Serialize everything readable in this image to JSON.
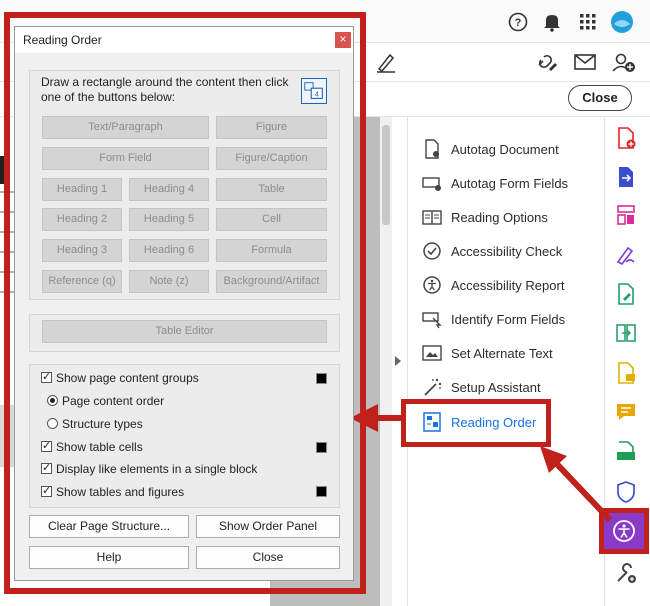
{
  "app": {
    "close_label": "Close"
  },
  "tool_panel": {
    "items": [
      {
        "label": "Autotag Document",
        "icon": "autotag-document-icon"
      },
      {
        "label": "Autotag Form Fields",
        "icon": "autotag-form-fields-icon"
      },
      {
        "label": "Reading Options",
        "icon": "reading-options-icon"
      },
      {
        "label": "Accessibility Check",
        "icon": "accessibility-check-icon"
      },
      {
        "label": "Accessibility Report",
        "icon": "accessibility-report-icon"
      },
      {
        "label": "Identify Form Fields",
        "icon": "identify-form-fields-icon"
      },
      {
        "label": "Set Alternate Text",
        "icon": "set-alternate-text-icon"
      },
      {
        "label": "Setup Assistant",
        "icon": "setup-assistant-icon"
      },
      {
        "label": "Reading Order",
        "icon": "reading-order-icon",
        "active": true
      }
    ]
  },
  "dialog": {
    "title": "Reading Order",
    "instructions": "Draw a rectangle around the content then click one of the buttons below:",
    "tag_buttons": [
      "Text/Paragraph",
      "Figure",
      "Form Field",
      "Figure/Caption",
      "Heading 1",
      "Heading 4",
      "Table",
      "Heading 2",
      "Heading 5",
      "Cell",
      "Heading 3",
      "Heading 6",
      "Formula",
      "Reference (q)",
      "Note (z)",
      "Background/Artifact"
    ],
    "table_editor": "Table Editor",
    "options": {
      "show_page_content_groups": "Show page content groups",
      "page_content_order": "Page content order",
      "structure_types": "Structure types",
      "show_table_cells": "Show table cells",
      "display_like_elements": "Display like elements in a single block",
      "show_tables_and_figures": "Show tables and figures"
    },
    "buttons": {
      "clear_structure": "Clear Page Structure...",
      "show_order_panel": "Show Order Panel",
      "help": "Help",
      "close": "Close"
    }
  },
  "colors": {
    "highlight": "#c0221b",
    "accent": "#1473e6",
    "accessibility": "#8a39c9"
  }
}
